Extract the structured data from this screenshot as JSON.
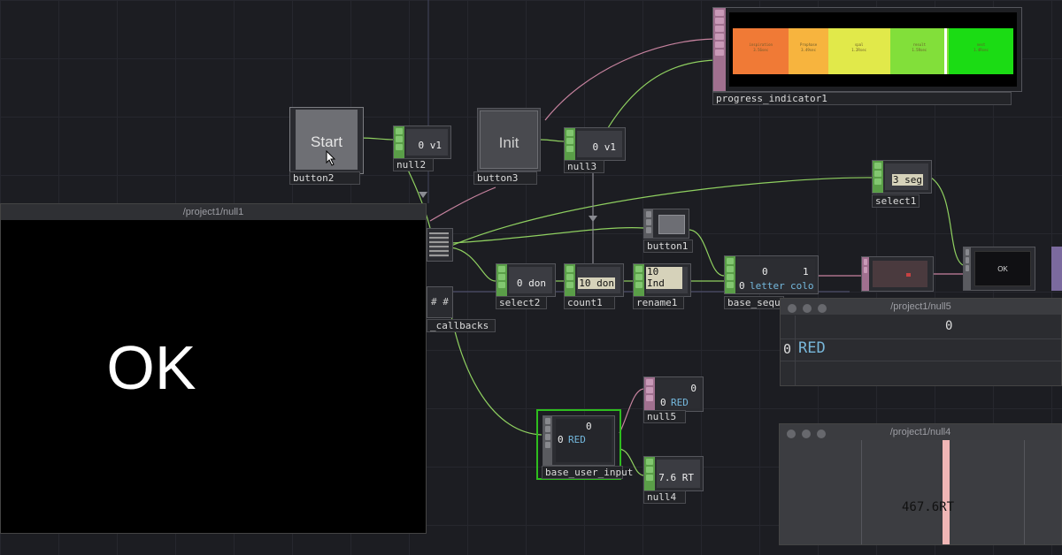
{
  "window_ok": {
    "title": "/project1/null1",
    "text": "OK"
  },
  "window_null5": {
    "title": "/project1/null5",
    "col_header": "0",
    "row_index": "0",
    "cell_value": "RED"
  },
  "window_null4": {
    "title": "/project1/null4",
    "value": "467.6RT"
  },
  "progress": {
    "label": "progress_indicator1",
    "segments": [
      {
        "name": "segment0",
        "label": "inspiration\n3.56sec",
        "color": "#f07a36",
        "fraction": 0.2
      },
      {
        "name": "segment1",
        "label": "Prophase\n3.49sec",
        "color": "#f7b43e",
        "fraction": 0.14
      },
      {
        "name": "segment2",
        "label": "spal\n1.2Rsec",
        "color": "#e1e94a",
        "fraction": 0.22
      },
      {
        "name": "segment3",
        "label": "result\n1.5Rsec",
        "color": "#82df3a",
        "fraction": 0.21
      },
      {
        "name": "segment4",
        "label": "nest\n1.4Rsec",
        "color": "#1bdc14",
        "fraction": 0.23
      }
    ],
    "marker_fraction": 0.755
  },
  "nodes": {
    "button2": {
      "label": "button2",
      "caption": "Start"
    },
    "button3": {
      "label": "button3",
      "caption": "Init"
    },
    "null2": {
      "label": "null2",
      "value": "0 v1"
    },
    "null3": {
      "label": "null3",
      "value": "0 v1"
    },
    "select1": {
      "label": "select1",
      "value": "3 seg"
    },
    "button1": {
      "label": "button1"
    },
    "select2": {
      "label": "select2",
      "value": "0 don"
    },
    "count1": {
      "label": "count1",
      "value": "10 don"
    },
    "rename1": {
      "label": "rename1",
      "value": "10 Ind"
    },
    "base_sequence": {
      "label": "base_seque",
      "col0": "0",
      "col1": "1",
      "row": "0",
      "cell0": "letter",
      "cell1": "colo"
    },
    "ok_top": {
      "value": "OK"
    },
    "callbacks": {
      "label": "_callbacks",
      "value": "# #"
    },
    "null5": {
      "label": "null5",
      "head": "0",
      "row": "0",
      "cell": "RED"
    },
    "base_user_input": {
      "label": "base_user_input",
      "head": "0",
      "row": "0",
      "cell": "RED"
    },
    "null4": {
      "label": "null4",
      "value": "7.6 RT"
    }
  }
}
